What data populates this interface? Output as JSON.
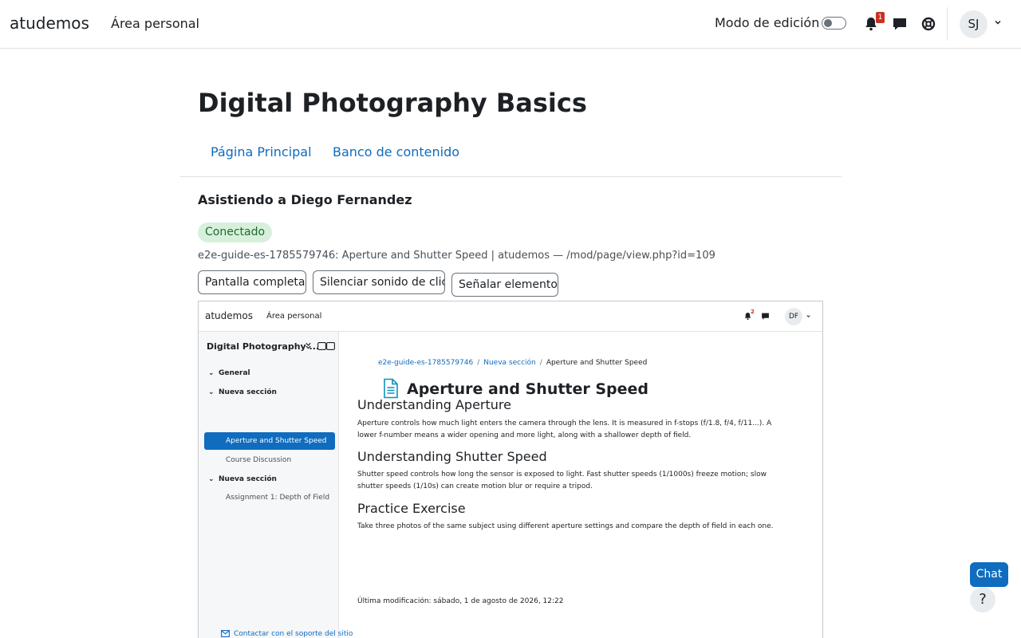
{
  "navbar": {
    "brand": "atudemos",
    "home_link": "Área personal",
    "edit_mode_label": "Modo de edición",
    "notification_count": "1",
    "user_initials": "SJ"
  },
  "course": {
    "title": "Digital Photography Basics",
    "tabs": [
      "Página Principal",
      "Banco de contenido"
    ]
  },
  "assist": {
    "title": "Asistiendo a Diego Fernandez",
    "status": "Conectado",
    "info": "e2e-guide-es-1785579746: Aperture and Shutter Speed | atudemos — /mod/page/view.php?id=109",
    "buttons": [
      "Pantalla completa",
      "Silenciar sonido de clic",
      "Señalar elemento"
    ]
  },
  "frame": {
    "brand": "atudemos",
    "home_link": "Área personal",
    "notification_count": "2",
    "user_initials": "DF",
    "drawer": {
      "title": "Digital Photography ...",
      "items": [
        {
          "label": "General",
          "type": "section"
        },
        {
          "label": "Nueva sección",
          "type": "section"
        },
        {
          "label": "Aperture and Shutter Speed",
          "type": "active"
        },
        {
          "label": "Course Discussion",
          "type": "sub"
        },
        {
          "label": "Nueva sección",
          "type": "section"
        },
        {
          "label": "Assignment 1: Depth of Field",
          "type": "sub"
        }
      ]
    },
    "breadcrumb": [
      "e2e-guide-es-1785579746",
      "Nueva sección",
      "Aperture and Shutter Speed"
    ],
    "page_title": "Aperture and Shutter Speed",
    "sections": [
      {
        "heading": "Understanding Aperture",
        "text": "Aperture controls how much light enters the camera through the lens. It is measured in f-stops (f/1.8, f/4, f/11...). A lower f-number means a wider opening and more light, along with a shallower depth of field."
      },
      {
        "heading": "Understanding Shutter Speed",
        "text": "Shutter speed controls how long the sensor is exposed to light. Fast shutter speeds (1/1000s) freeze motion; slow shutter speeds (1/10s) can create motion blur or require a tripod."
      },
      {
        "heading": "Practice Exercise",
        "text": "Take three photos of the same subject using different aperture settings and compare the depth of field in each one."
      }
    ],
    "last_modified": "Última modificación: sábado, 1 de agosto de 2026, 12:22",
    "support_link": "Contactar con el soporte del sitio"
  },
  "floating": {
    "chat_label": "Chat",
    "help_label": "?"
  },
  "colors": {
    "accent": "#0f6cbf",
    "badge": "#ca3120",
    "status_bg": "#d7f0dc"
  }
}
